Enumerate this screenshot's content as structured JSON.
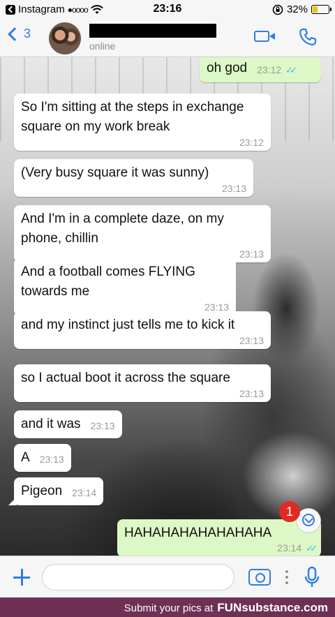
{
  "status_bar": {
    "carrier": "Instagram",
    "signal": "●oooo",
    "time": "23:16",
    "battery": "32%"
  },
  "header": {
    "back_count": "3",
    "contact_status": "online"
  },
  "messages": [
    {
      "direction": "out",
      "text": "oh god",
      "time": "23:12",
      "read": true
    },
    {
      "direction": "in",
      "text": "So I'm sitting at the steps in exchange square on my work break",
      "time": "23:12"
    },
    {
      "direction": "in",
      "text": "(Very busy square it was sunny)",
      "time": "23:13"
    },
    {
      "direction": "in",
      "text": "And I'm in a complete daze, on my phone, chillin",
      "time": "23:13"
    },
    {
      "direction": "in",
      "text": "And a football comes FLYING towards me",
      "time": "23:13"
    },
    {
      "direction": "in",
      "text": "and my instinct just tells me to kick it",
      "time": "23:13"
    },
    {
      "direction": "in",
      "text": "so I actual boot it across the square",
      "time": "23:13"
    },
    {
      "direction": "in",
      "text": "and it was",
      "time": "23:13"
    },
    {
      "direction": "in",
      "text": "A",
      "time": "23:13"
    },
    {
      "direction": "in",
      "text": "Pigeon",
      "time": "23:14"
    },
    {
      "direction": "out",
      "text": "HAHAHAHAHAHAHAHA",
      "time": "23:14",
      "read": true
    }
  ],
  "unread_badge": "1",
  "input": {
    "placeholder": ""
  },
  "footer": {
    "text": "Submit your pics at",
    "brand": "FUNsubstance.com"
  },
  "colors": {
    "accent": "#2f7de1",
    "outgoing_bubble": "#dcf8c6",
    "incoming_bubble": "#ffffff",
    "badge": "#e02b24",
    "footer": "#6e3154",
    "read_ticks": "#4fb6ec"
  },
  "icons": [
    "back-chevron-icon",
    "video-call-icon",
    "phone-icon",
    "plus-icon",
    "camera-icon",
    "more-icon",
    "microphone-icon",
    "scroll-down-icon",
    "wifi-icon",
    "lock-rotation-icon",
    "battery-icon"
  ]
}
